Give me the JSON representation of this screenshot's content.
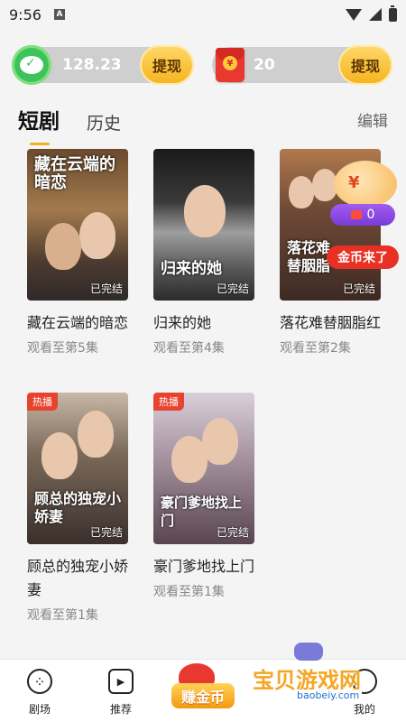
{
  "status_bar": {
    "time": "9:56",
    "notif_letter": "A"
  },
  "balances": [
    {
      "icon": "wechat-icon",
      "amount": "128.23",
      "action": "提现"
    },
    {
      "icon": "red-packet-icon",
      "amount": "20",
      "action": "提现"
    }
  ],
  "tabs": {
    "items": [
      "短剧",
      "历史"
    ],
    "active": "短剧",
    "edit_label": "编辑"
  },
  "dramas": [
    {
      "title": "藏在云端的暗恋",
      "poster_title": "藏在云端的暗恋",
      "progress": "观看至第5集",
      "finished": "已完结",
      "hot": ""
    },
    {
      "title": "归来的她",
      "poster_title": "归来的她",
      "progress": "观看至第4集",
      "finished": "已完结",
      "hot": ""
    },
    {
      "title": "落花难替胭脂红",
      "poster_title": "落花难替胭脂",
      "progress": "观看至第2集",
      "finished": "已完结",
      "hot": ""
    },
    {
      "title": "顾总的独宠小娇妻",
      "poster_title": "顾总的独宠小娇妻",
      "progress": "观看至第1集",
      "finished": "已完结",
      "hot": "热播"
    },
    {
      "title": "豪门爹地找上门",
      "poster_title": "豪门爹地找上门",
      "progress": "观看至第1集",
      "finished": "已完结",
      "hot": "热播"
    }
  ],
  "coin_widget": {
    "symbol": "¥",
    "count": "0",
    "label": "金币来了"
  },
  "bottom_nav": {
    "items": [
      {
        "label": "剧场",
        "icon": "theater-icon"
      },
      {
        "label": "推荐",
        "icon": "play-icon"
      },
      {
        "label": "赚金币",
        "icon": "coin-bag-icon"
      },
      {
        "label": "我的",
        "icon": "profile-icon"
      }
    ]
  },
  "watermark": {
    "text": "宝贝游戏网",
    "url": "baobeiy.com"
  }
}
